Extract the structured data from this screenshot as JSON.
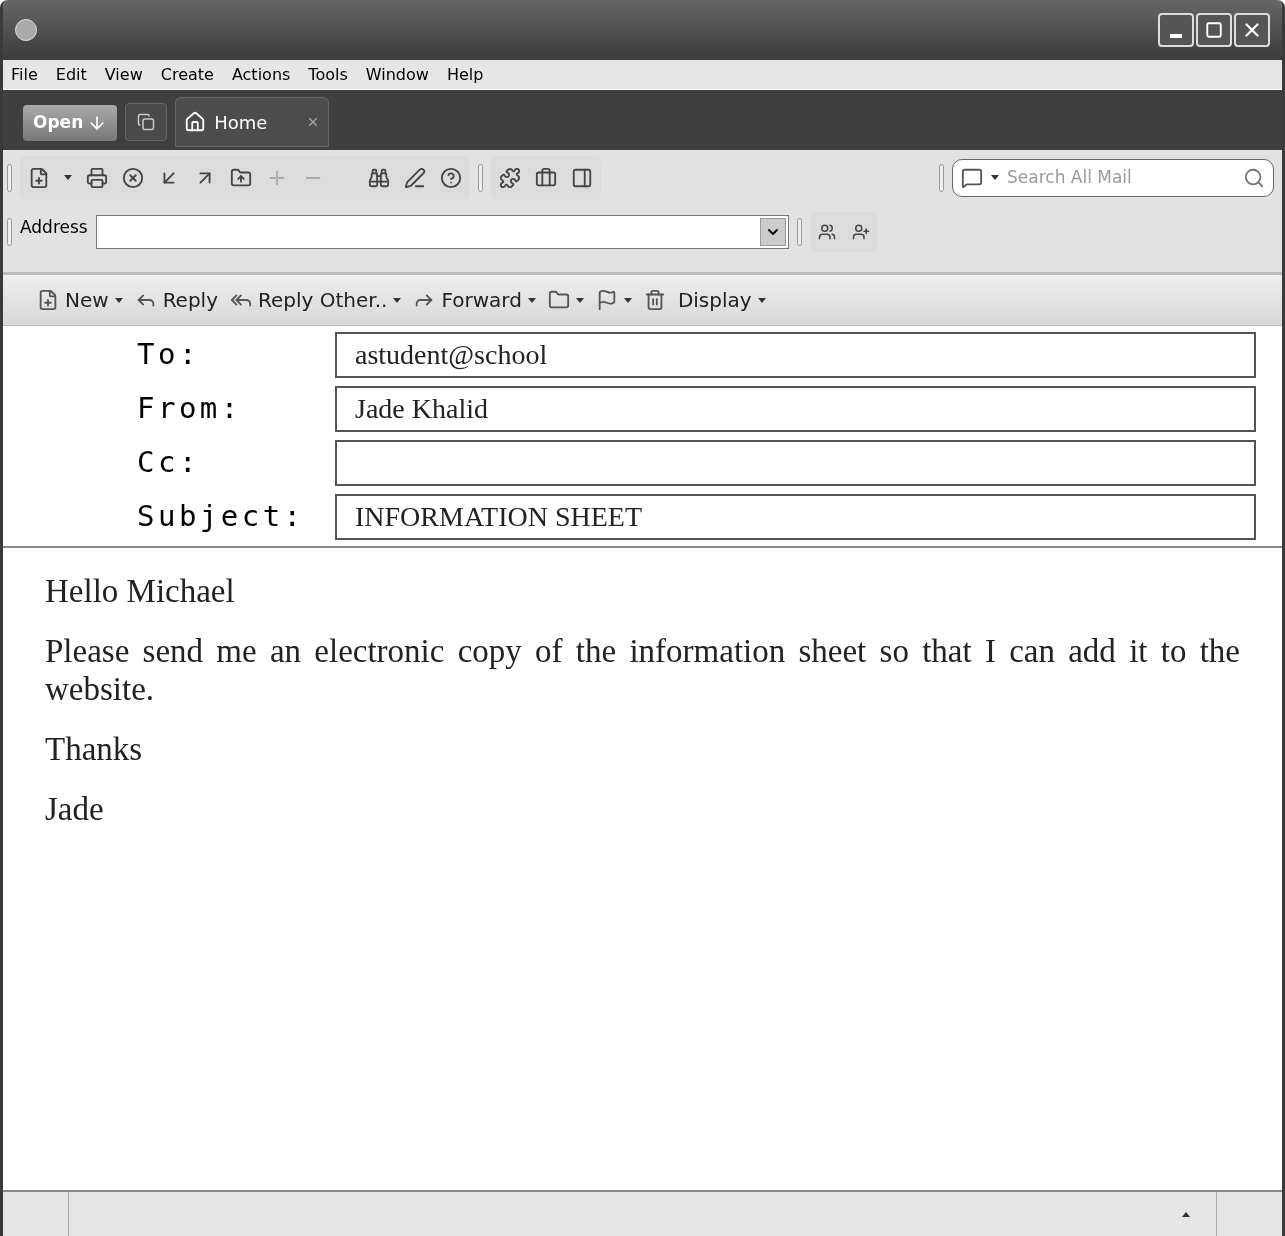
{
  "menu": [
    "File",
    "Edit",
    "View",
    "Create",
    "Actions",
    "Tools",
    "Window",
    "Help"
  ],
  "open_button": "Open",
  "tabs": [
    {
      "label": "Home",
      "selected": true
    }
  ],
  "search": {
    "placeholder": "Search All Mail"
  },
  "address": {
    "label": "Address"
  },
  "message_toolbar": [
    {
      "label": "New",
      "dropdown": true
    },
    {
      "label": "Reply",
      "dropdown": false
    },
    {
      "label": "Reply Other..",
      "dropdown": true
    },
    {
      "label": "Forward",
      "dropdown": true
    },
    {
      "dropdown": true
    },
    {
      "dropdown": true
    },
    {
      "dropdown": false
    },
    {
      "label": "Display",
      "dropdown": true
    }
  ],
  "headers": [
    {
      "label": "To:",
      "value": "astudent@school"
    },
    {
      "label": "From:",
      "value": "Jade Khalid"
    },
    {
      "label": "Cc:"
    },
    {
      "label": "Subject:",
      "value": "INFORMATION SHEET"
    }
  ],
  "body": [
    "Hello Michael",
    "Please send me an electronic copy of the information sheet so that I can add it to the website.",
    "Thanks",
    "Jade"
  ]
}
